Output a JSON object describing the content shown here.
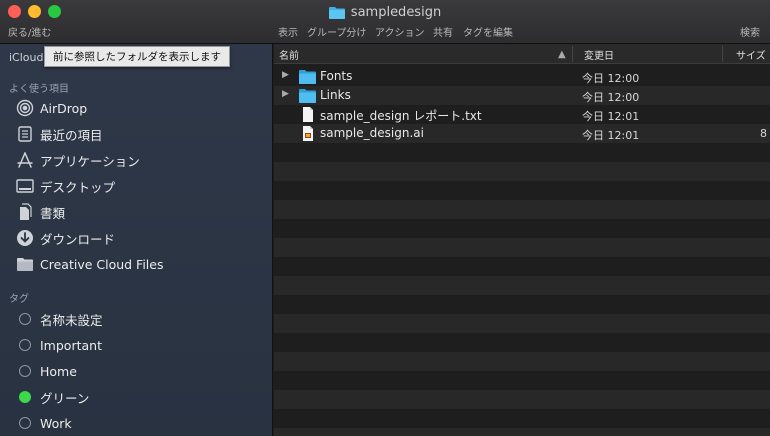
{
  "window": {
    "title": "sampledesign"
  },
  "toolbar": {
    "back_forward": "戻る/進む",
    "view": "表示",
    "group": "グループ分け",
    "action": "アクション",
    "share": "共有",
    "edit_tags": "タグを編集",
    "search": "検索"
  },
  "tooltip": "前に参照したフォルダを表示します",
  "sidebar": {
    "icloud": "iCloud",
    "favorites_header": "よく使う項目",
    "favorites": [
      {
        "label": "AirDrop",
        "icon": "airdrop-icon"
      },
      {
        "label": "最近の項目",
        "icon": "recents-icon"
      },
      {
        "label": "アプリケーション",
        "icon": "applications-icon"
      },
      {
        "label": "デスクトップ",
        "icon": "desktop-icon"
      },
      {
        "label": "書類",
        "icon": "documents-icon"
      },
      {
        "label": "ダウンロード",
        "icon": "downloads-icon"
      },
      {
        "label": "Creative Cloud Files",
        "icon": "folder-icon"
      }
    ],
    "tags_header": "タグ",
    "tags": [
      {
        "label": "名称未設定",
        "color": ""
      },
      {
        "label": "Important",
        "color": ""
      },
      {
        "label": "Home",
        "color": ""
      },
      {
        "label": "グリーン",
        "color": "#3bd94b"
      },
      {
        "label": "Work",
        "color": ""
      }
    ]
  },
  "columns": {
    "name": "名前",
    "date_modified": "変更日",
    "size": "サイズ"
  },
  "files": [
    {
      "name": "Fonts",
      "type": "folder",
      "date": "今日 12:00",
      "size": ""
    },
    {
      "name": "Links",
      "type": "folder",
      "date": "今日 12:00",
      "size": ""
    },
    {
      "name": "sample_design レポート.txt",
      "type": "text",
      "date": "今日 12:01",
      "size": ""
    },
    {
      "name": "sample_design.ai",
      "type": "illustrator",
      "date": "今日 12:01",
      "size": "8"
    }
  ],
  "colors": {
    "folder_blue": "#3fb3e8",
    "sidebar_bg": "#2b3545",
    "window_bg": "#1e1e1e"
  }
}
